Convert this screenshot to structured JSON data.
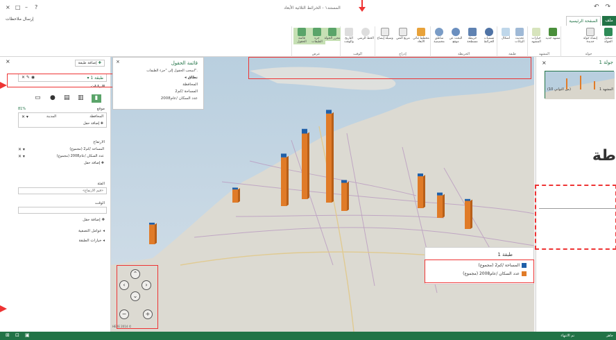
{
  "titlebar": {
    "doc_title": "المستند١ - الخرائط الثلاثية الأبعاد",
    "feedback": "إرسال ملاحظات",
    "controls": [
      "?",
      "□",
      "–",
      "×"
    ],
    "qat": [
      "↶",
      "↷"
    ]
  },
  "ribbon": {
    "tab_home": "الصفحة الرئيسية",
    "tab_file": "ملف",
    "groups": [
      {
        "label": "جولة",
        "buttons": [
          "تشغيل الجولة",
          "إنشاء جولة جديدة"
        ]
      },
      {
        "label": "المشهد",
        "buttons": [
          "مشهد جديد",
          "سمات",
          "خيارات المشهد"
        ]
      },
      {
        "label": "طبقة",
        "buttons": [
          "تحديث البيانات",
          "أشكال"
        ]
      },
      {
        "label": "الخريطة",
        "buttons": [
          "تسميات الخرائط",
          "خريطة مسطحة",
          "البحث عن موقع",
          "مناطق مخصصة"
        ]
      },
      {
        "label": "إدراج",
        "buttons": [
          "مخطط ثنائي الأبعاد",
          "مربع النص",
          "وسيلة إيضاح"
        ]
      },
      {
        "label": "الوقت",
        "buttons": [
          "الخط الزمني",
          "التاريخ والوقت"
        ]
      },
      {
        "label": "عرض",
        "buttons": [
          "محرر الجولة",
          "جزء الطبقات",
          "قائمة الحقول"
        ]
      }
    ]
  },
  "layer_pane": {
    "add_layer": "إضافة طبقة",
    "layer_name": "طبقة 1",
    "data_section": "البيانات",
    "location_label": "موقع",
    "location_pct": "81%",
    "location_fields": [
      {
        "name": "المحافظة",
        "type": "المدينة"
      }
    ],
    "add_field": "إضافة حقل",
    "height_label": "الارتفاع",
    "height_fields": [
      "المساحة /كم2 (مجموع)",
      "عدد السكان /عام2008 (مجموع)"
    ],
    "category_label": "الفئة",
    "category_placeholder": "«قيم الارتفاع»",
    "time_label": "الوقت",
    "filters": "عوامل التصفية",
    "layer_options": "خيارات الطبقة"
  },
  "field_list": {
    "title": "قائمة الحقول",
    "hint": "اسحب الحقول إلى \"جزء الطبقات\".",
    "range": "نطاق",
    "fields": [
      "المحافظة",
      "المساحة /كم2",
      "عدد السكان /عام2008"
    ]
  },
  "right_pane": {
    "tour_title": "جولة 1",
    "scene_label": "المشهد 1",
    "scene_time": "(10 من الثواني)",
    "big_text": "طة"
  },
  "legend": {
    "title": "طبقة 1",
    "items": [
      {
        "label": "المساحة /كم2 (مجموع)",
        "color": "#1f5fa8"
      },
      {
        "label": "عدد السكان /عام2008 (مجموع)",
        "color": "#e07b28"
      }
    ]
  },
  "map": {
    "copyright": "HERE 2014 ©"
  },
  "status": {
    "done": "تم الانتهاء",
    "ready": "جاهز"
  },
  "chart_data": {
    "type": "bar",
    "series": [
      {
        "name": "المساحة /كم2 (مجموع)",
        "color": "#1f5fa8"
      },
      {
        "name": "عدد السكان /عام2008 (مجموع)",
        "color": "#e07b28"
      }
    ],
    "bars": [
      {
        "population": 95,
        "area": 4
      },
      {
        "population": 70,
        "area": 5
      },
      {
        "population": 52,
        "area": 4
      },
      {
        "population": 34,
        "area": 3
      },
      {
        "population": 30,
        "area": 3
      },
      {
        "population": 30,
        "area": 2
      },
      {
        "population": 24,
        "area": 3
      },
      {
        "population": 21,
        "area": 2
      },
      {
        "population": 14,
        "area": 2
      }
    ]
  }
}
